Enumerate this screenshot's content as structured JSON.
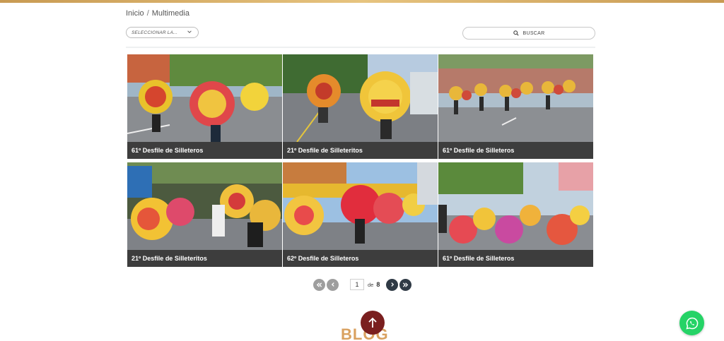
{
  "breadcrumb": {
    "home": "Inicio",
    "separator": "/",
    "current": "Multimedia"
  },
  "filter": {
    "placeholder": "SELECCIONAR LA...",
    "icon": "chevron-down-icon"
  },
  "search": {
    "label": "BUSCAR",
    "icon": "search-icon"
  },
  "gallery": {
    "items": [
      {
        "caption": "61º Desfile de Silleteros"
      },
      {
        "caption": "21º Desfile de Silleteritos"
      },
      {
        "caption": "61º Desfile de Silleteros"
      },
      {
        "caption": "21º Desfile de Silleteritos"
      },
      {
        "caption": "62º Desfile de Silleteros"
      },
      {
        "caption": "61º Desfile de Silleteros"
      }
    ]
  },
  "pagination": {
    "current_page": "1",
    "of_label": "de",
    "total_pages": "8"
  },
  "blog": {
    "title": "BLOG"
  },
  "colors": {
    "accent": "#d9a160",
    "caption_bg": "#3d3d3d",
    "scroll_top": "#7a1f1f",
    "whatsapp": "#25d366"
  }
}
